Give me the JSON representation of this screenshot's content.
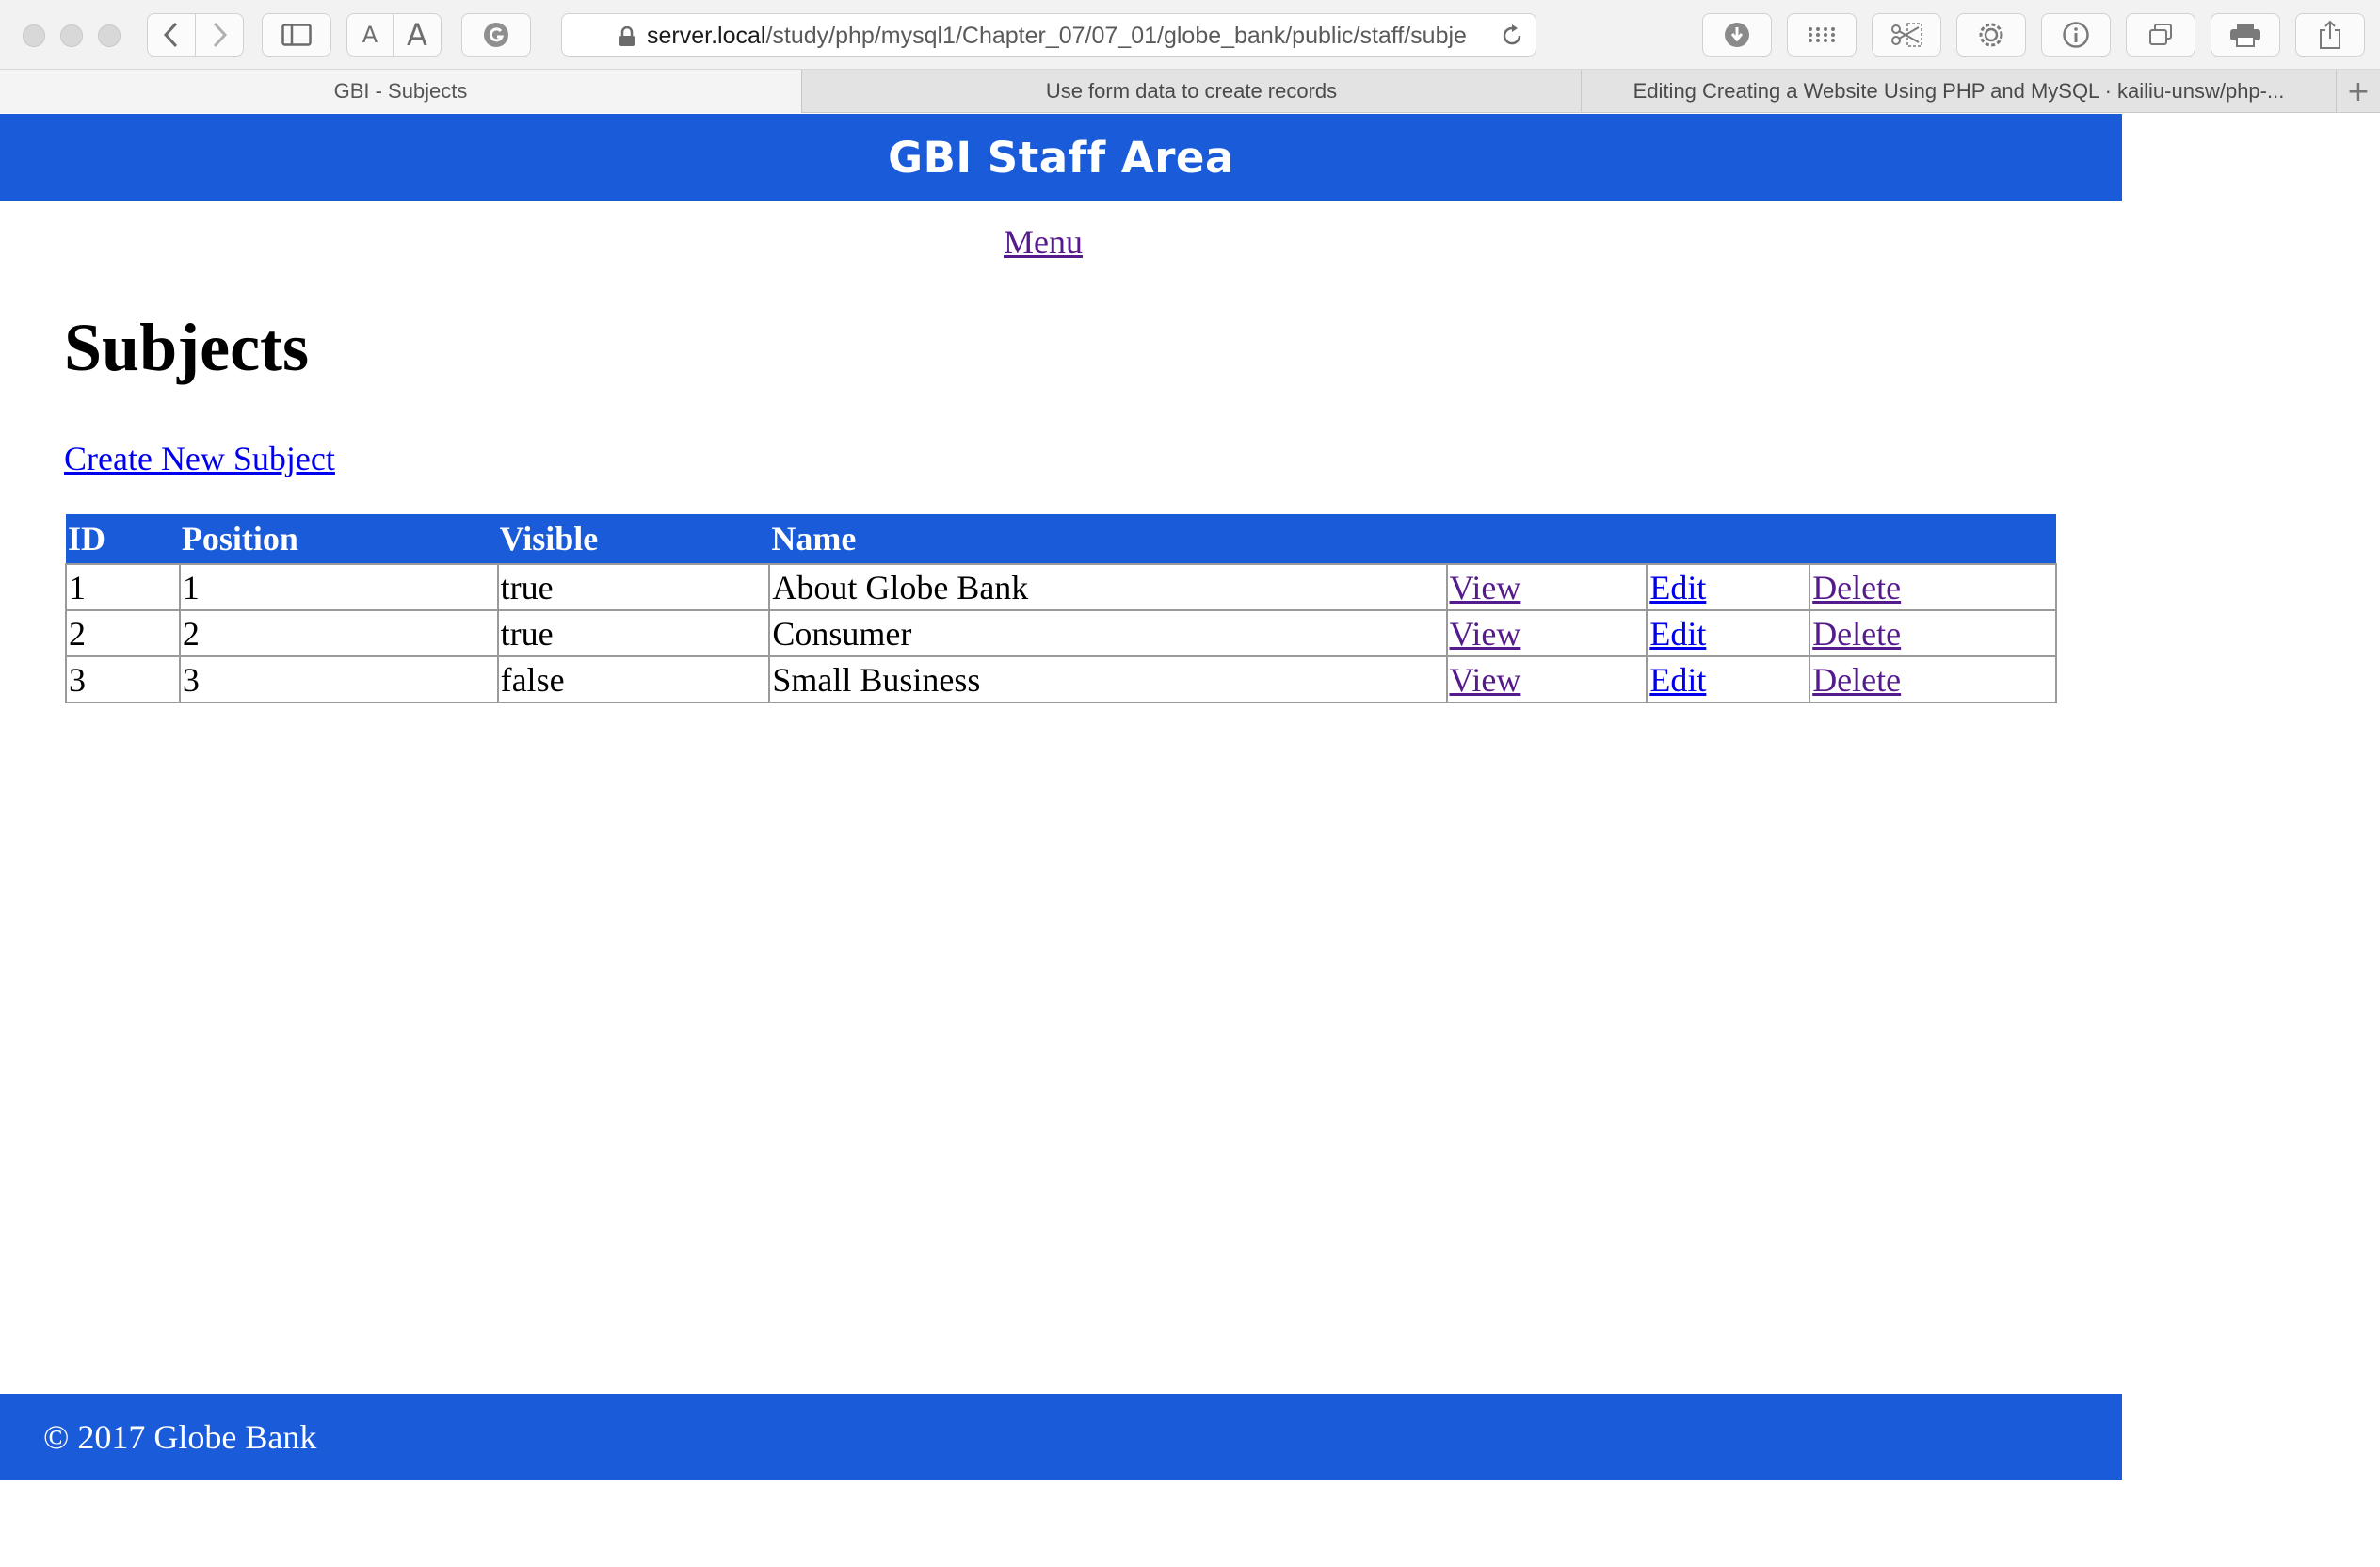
{
  "browser": {
    "url_host": "server.local",
    "url_path": "/study/php/mysql1/Chapter_07/07_01/globe_bank/public/staff/subje",
    "tabs": [
      {
        "label": "GBI - Subjects",
        "active": true
      },
      {
        "label": "Use form data to create records",
        "active": false
      },
      {
        "label": "Editing Creating a Website Using PHP and MySQL · kailiu-unsw/php-...",
        "active": false
      }
    ],
    "font_small_label": "A",
    "font_large_label": "A",
    "new_tab": "+"
  },
  "header": {
    "title": "GBI Staff Area"
  },
  "nav": {
    "menu_label": "Menu"
  },
  "main": {
    "title": "Subjects",
    "create_link": "Create New Subject",
    "table": {
      "columns": [
        "ID",
        "Position",
        "Visible",
        "Name"
      ],
      "rows": [
        {
          "id": "1",
          "position": "1",
          "visible": "true",
          "name": "About Globe Bank",
          "view": "View",
          "edit": "Edit",
          "delete": "Delete"
        },
        {
          "id": "2",
          "position": "2",
          "visible": "true",
          "name": "Consumer",
          "view": "View",
          "edit": "Edit",
          "delete": "Delete"
        },
        {
          "id": "3",
          "position": "3",
          "visible": "false",
          "name": "Small Business",
          "view": "View",
          "edit": "Edit",
          "delete": "Delete"
        }
      ]
    }
  },
  "footer": {
    "text": "© 2017 Globe Bank"
  },
  "colors": {
    "brand_blue": "#1a5bd9",
    "visited_link": "#551a8b",
    "link": "#0000ee"
  }
}
